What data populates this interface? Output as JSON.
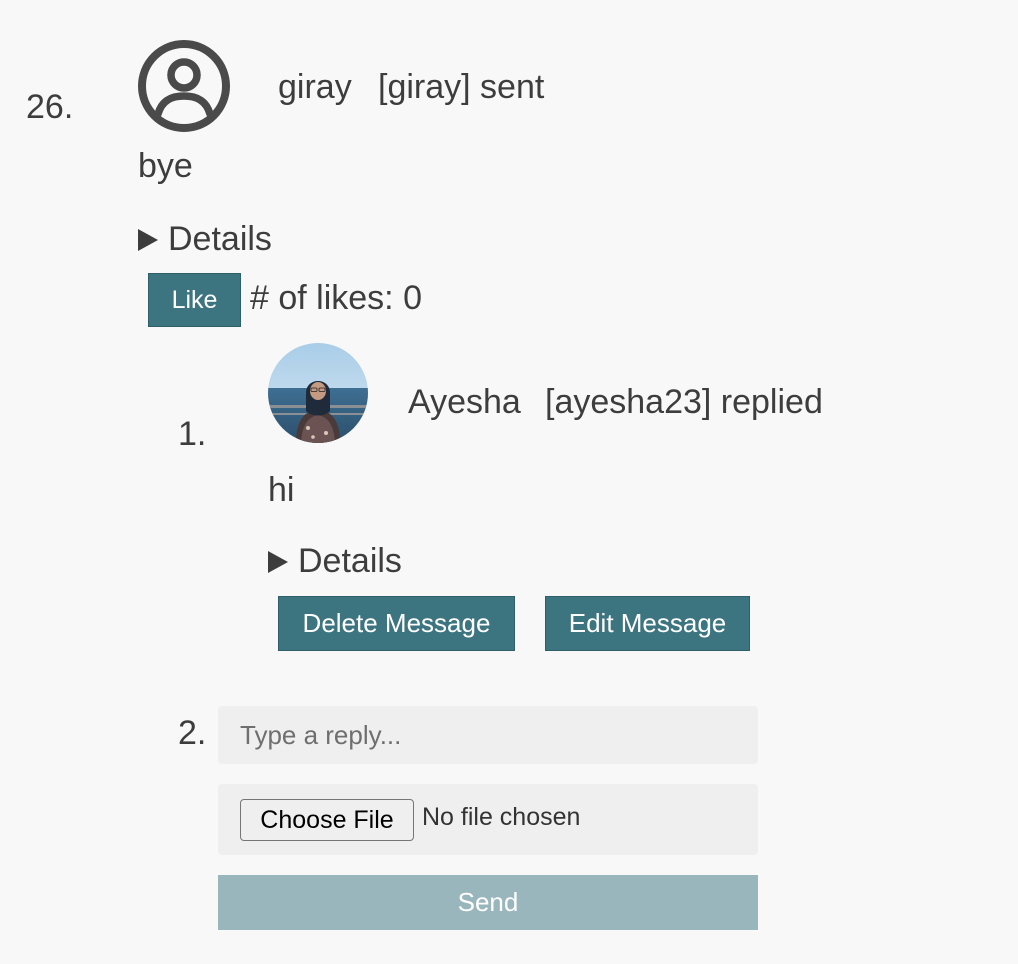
{
  "message": {
    "index": "26.",
    "avatar_icon": "user-circle-icon",
    "username": "giray",
    "handle_action": "[giray] sent",
    "body": "bye",
    "details_label": "Details",
    "like_label": "Like",
    "likes_text": "# of likes: 0"
  },
  "reply": {
    "index": "1.",
    "avatar": "profile-photo",
    "username": "Ayesha",
    "handle_action": "[ayesha23] replied",
    "body": "hi",
    "details_label": "Details",
    "delete_label": "Delete Message",
    "edit_label": "Edit Message"
  },
  "compose": {
    "index": "2.",
    "placeholder": "Type a reply...",
    "choose_file_label": "Choose File",
    "no_file_text": "No file chosen",
    "send_label": "Send"
  },
  "colors": {
    "button": "#3c7480",
    "send_disabled": "#99b6bd",
    "background": "#f8f8f8"
  }
}
